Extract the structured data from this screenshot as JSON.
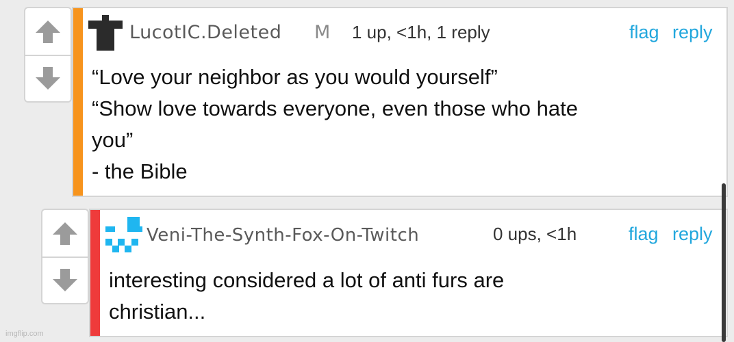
{
  "comments": [
    {
      "author": "LucotIC.Deleted",
      "badge": "M",
      "meta": "1 up, <1h, 1 reply",
      "flag_label": "flag",
      "reply_label": "reply",
      "body": "“Love your neighbor as you would yourself”\n“Show love towards everyone, even those who hate\nyou”\n- the Bible",
      "stripe_color": "#f7941d"
    },
    {
      "author": "Veni-The-Synth-Fox-On-Twitch",
      "meta": "0 ups, <1h",
      "flag_label": "flag",
      "reply_label": "reply",
      "body": "interesting considered a lot of anti furs are\nchristian...",
      "stripe_color": "#ef3b3b"
    }
  ],
  "icons": {
    "upvote": "arrow-up-icon",
    "downvote": "arrow-down-icon"
  },
  "colors": {
    "link": "#22a7dd",
    "avatar_cyan": "#1fb6f0"
  },
  "watermark": "imgflip.com"
}
